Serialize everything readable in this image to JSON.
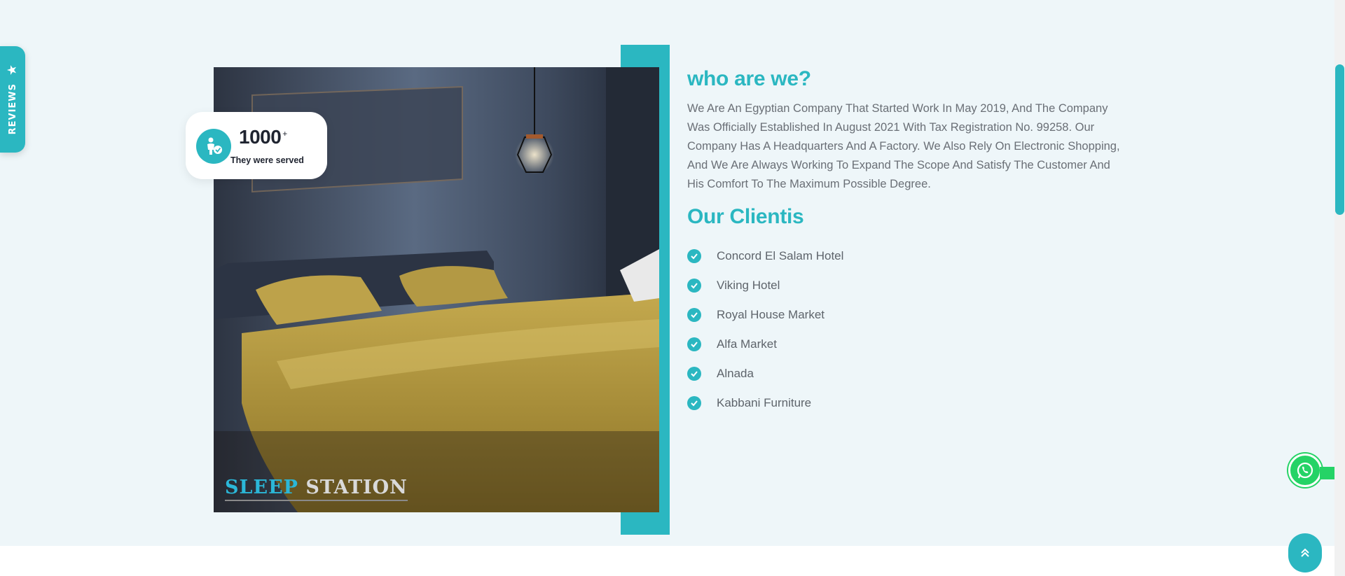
{
  "reviews_tab": {
    "label": "REVIEWS",
    "icon": "star-icon"
  },
  "stat": {
    "number": "1000",
    "suffix": "+",
    "caption": "They were served"
  },
  "photo": {
    "logo_part1": "SLEEP",
    "logo_part2": "STATION"
  },
  "about": {
    "heading": "who are we?",
    "paragraph": "We Are An Egyptian Company That Started Work In May 2019, And The Company Was Officially Established In August 2021 With Tax Registration No. 99258. Our Company Has A Headquarters And A Factory. We Also Rely On Electronic Shopping, And We Are Always Working To Expand The Scope And Satisfy The Customer And His Comfort To The Maximum Possible Degree."
  },
  "clients": {
    "heading": "Our Clientis",
    "items": [
      "Concord El Salam Hotel",
      "Viking Hotel",
      "Royal House Market",
      "Alfa Market",
      "Alnada",
      "Kabbani Furniture"
    ]
  },
  "colors": {
    "accent": "#2bb7c1",
    "whatsapp": "#25d366",
    "background": "#eef6f9"
  }
}
